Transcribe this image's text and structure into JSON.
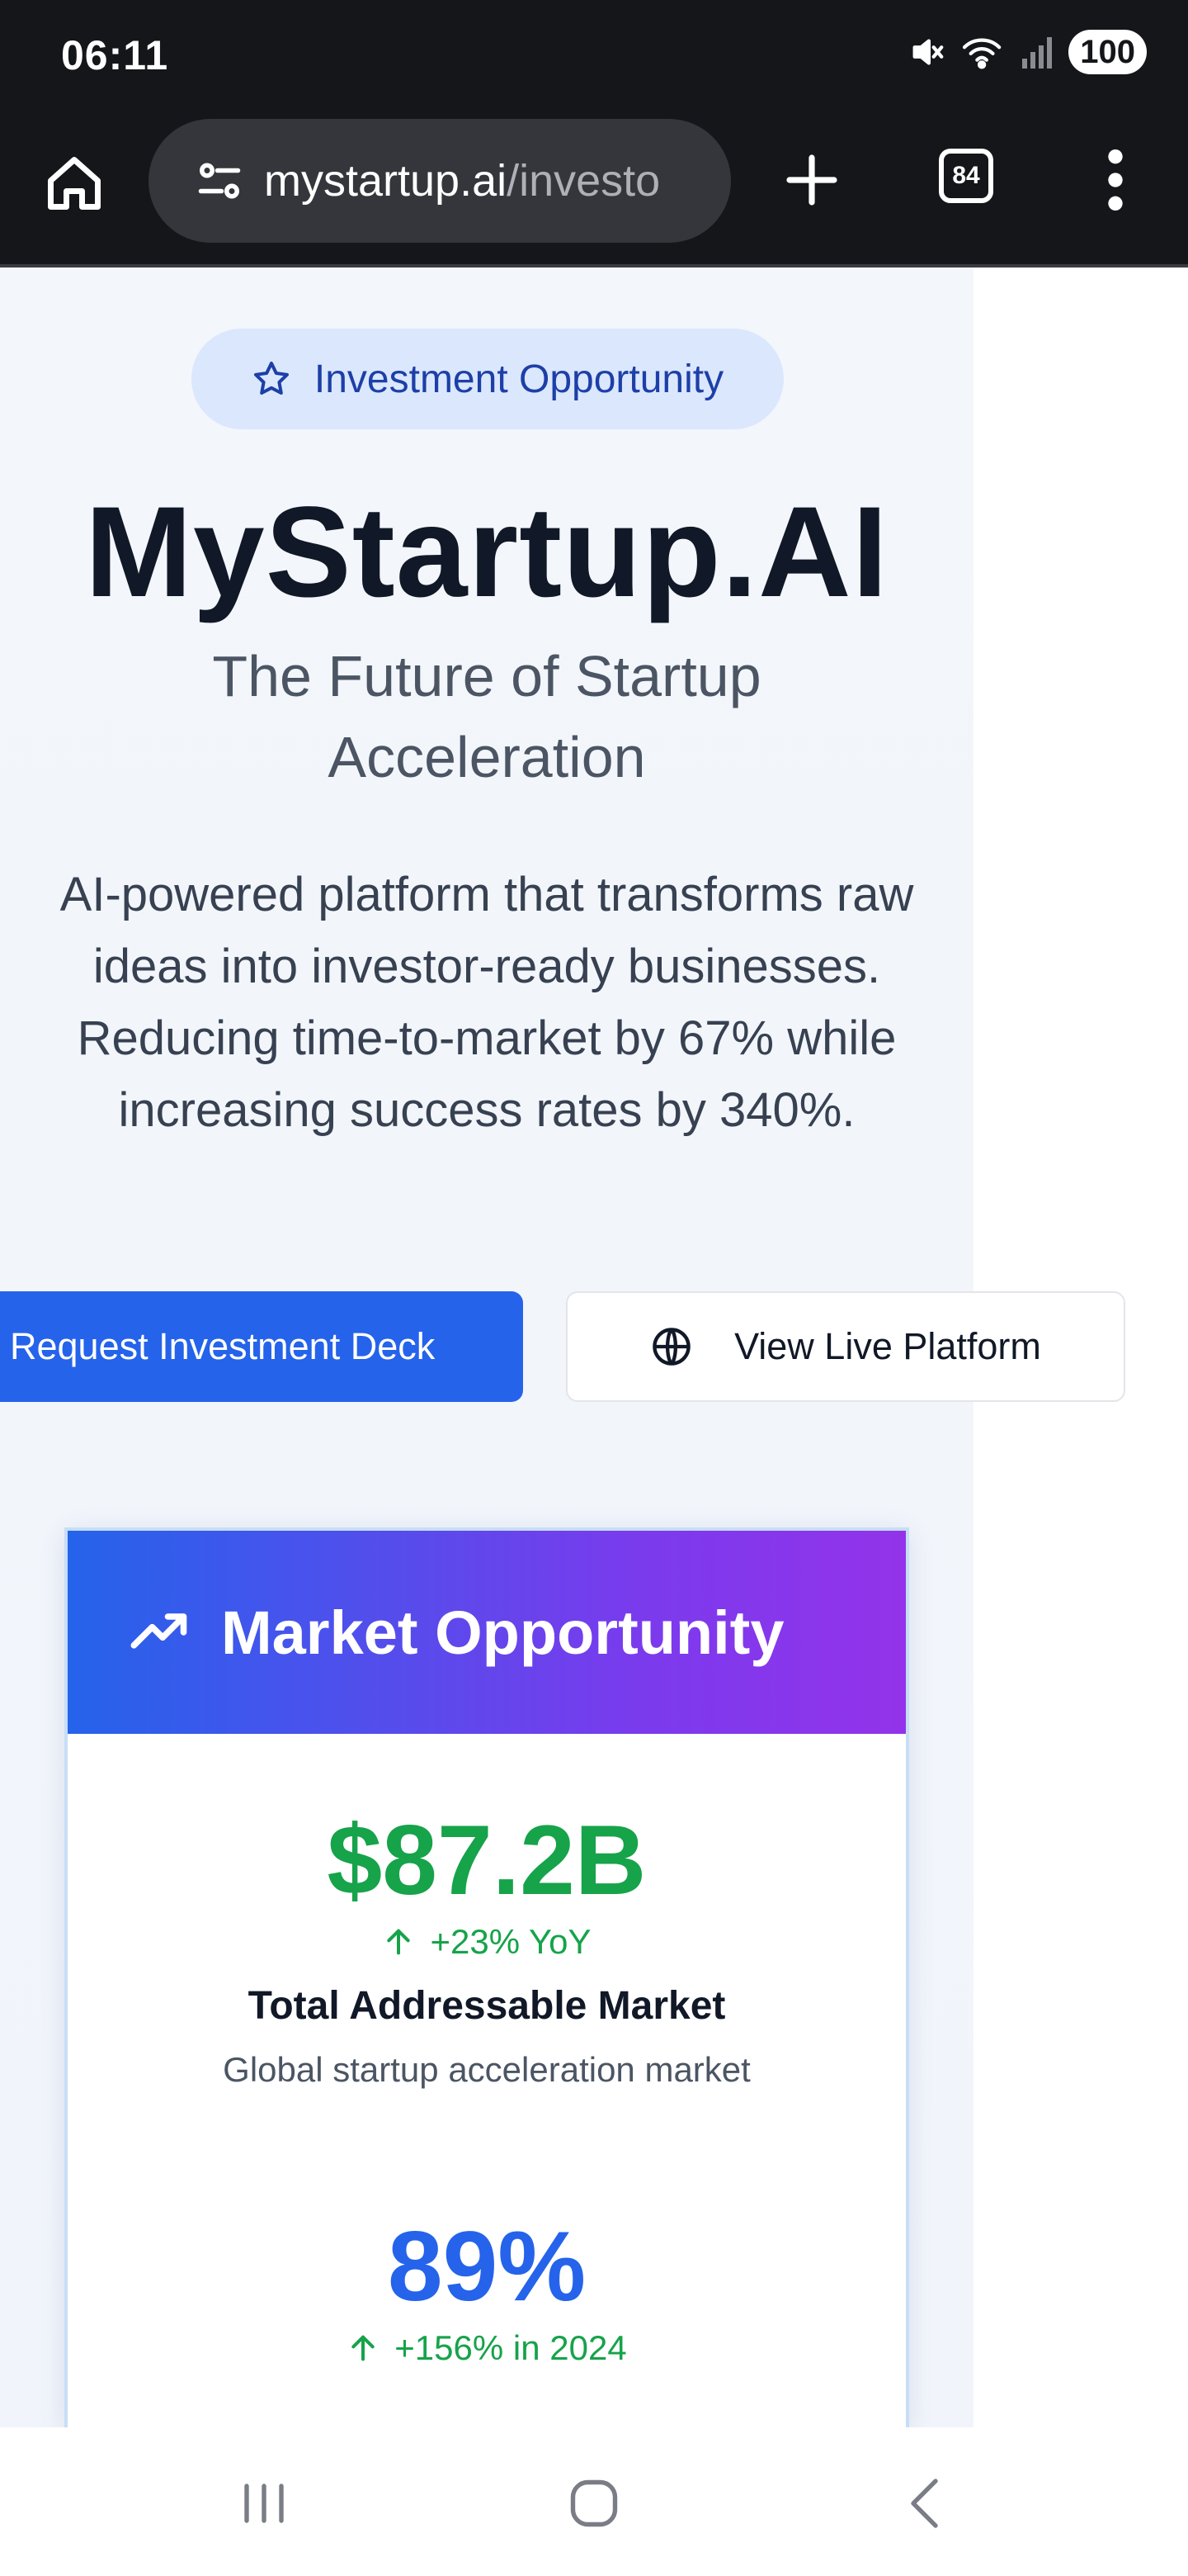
{
  "status_bar": {
    "time": "06:11",
    "battery": "100",
    "icons": [
      "mute-icon",
      "wifi-icon",
      "signal-icon"
    ]
  },
  "browser": {
    "url_host": "mystartup.ai",
    "url_path": "/investo",
    "tab_count": "84"
  },
  "hero": {
    "badge_label": "Investment Opportunity",
    "title": "MyStartup.AI",
    "subtitle": "The Future of Startup Acceleration",
    "description": "AI-powered platform that transforms raw ideas into investor-ready businesses. Reducing time-to-market by 67% while increasing success rates by 340%.",
    "primary_button": "Request Investment Deck",
    "secondary_button": "View Live Platform"
  },
  "market_card": {
    "title": "Market Opportunity",
    "metrics": [
      {
        "value": "$87.2B",
        "change": "+23% YoY",
        "label": "Total Addressable Market",
        "description": "Global startup acceleration market"
      },
      {
        "value": "89%",
        "change": "+156% in 2024",
        "label": "",
        "description": ""
      }
    ]
  },
  "colors": {
    "primary": "#2563eb",
    "green": "#16a34a",
    "blue_metric": "#2563eb",
    "gradient_end": "#9333ea"
  }
}
